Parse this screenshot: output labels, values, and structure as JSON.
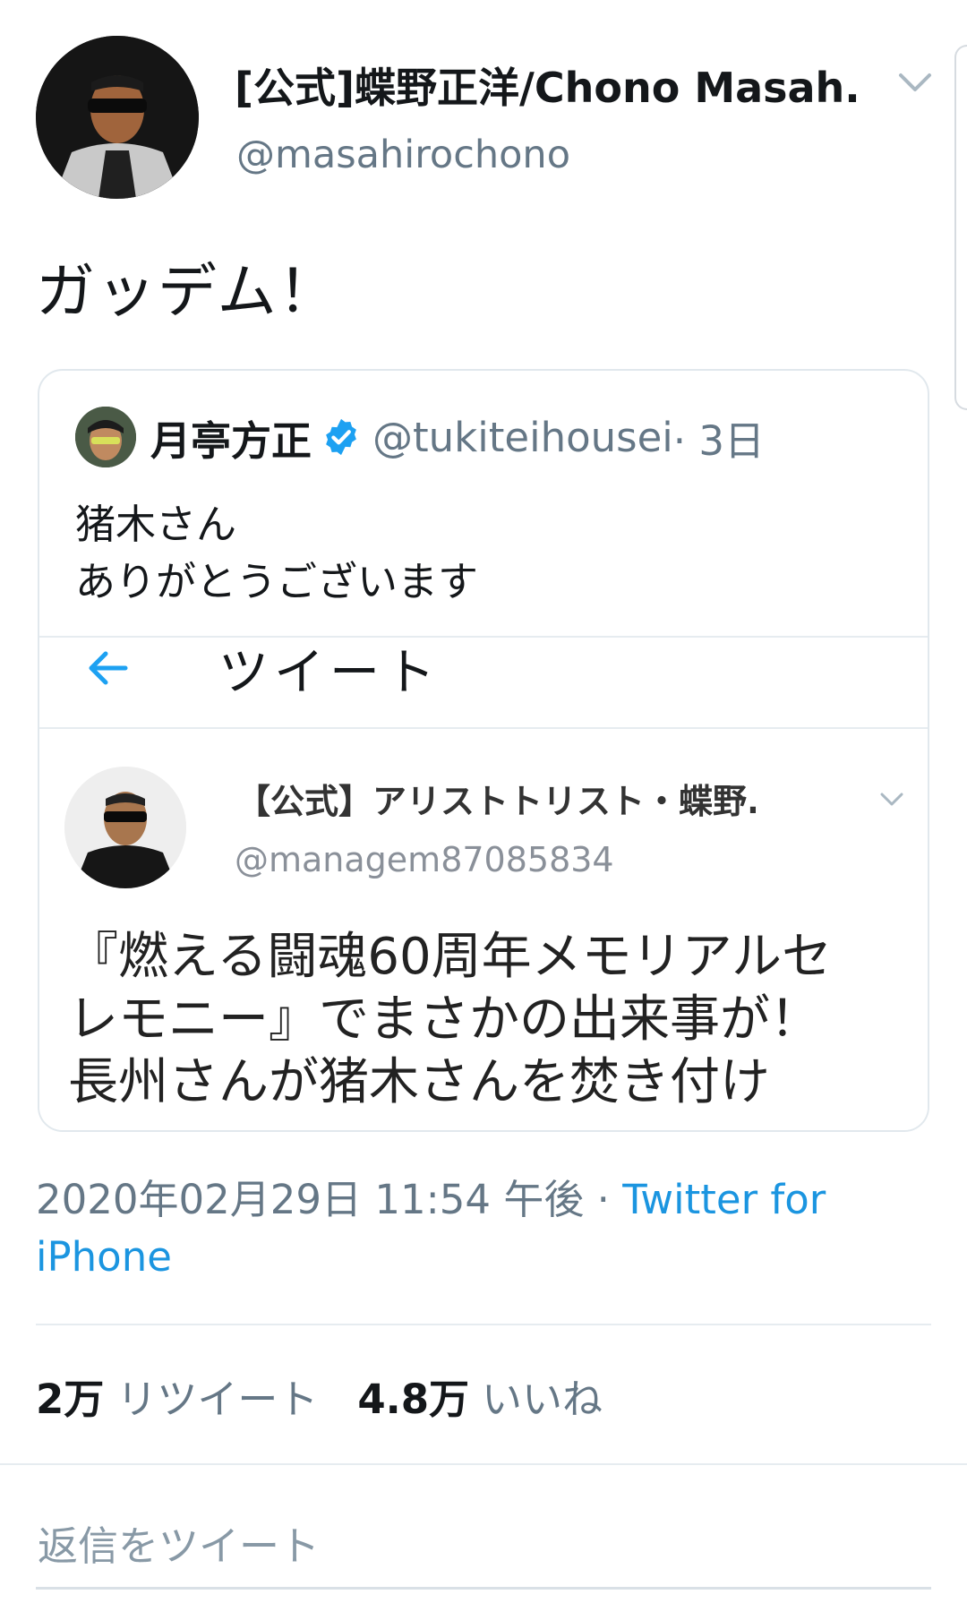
{
  "author": {
    "name": "[公式]蝶野正洋/Chono Masah...",
    "handle": "@masahirochono"
  },
  "tweet": {
    "text": "ガッデム！"
  },
  "quote": {
    "name": "月亭方正",
    "handle": "@tukiteihousei",
    "time": " · 3日",
    "lines": [
      "猪木さん",
      "ありがとうございます"
    ],
    "screenshot": {
      "title": "ツイート",
      "name": "【公式】アリストトリスト・蝶野...",
      "handle": "@managem87085834",
      "text_lines": [
        "『燃える闘魂60周年メモリアルセ",
        "レモニー』でまさかの出来事が！",
        "長州さんが猪木さんを焚き付け"
      ]
    }
  },
  "meta": {
    "datetime": "2020年02月29日 11:54 午後 · ",
    "source": "Twitter for iPhone"
  },
  "stats": {
    "retweets_count": "2万",
    "retweets_label": "リツイート",
    "likes_count": "4.8万",
    "likes_label": "いいね"
  },
  "reply": {
    "placeholder": "返信をツイート"
  },
  "icons": {
    "menu": "chevron-down-icon",
    "verified": "verified-badge-icon",
    "back": "back-arrow-icon"
  },
  "colors": {
    "link": "#1b95e0",
    "secondary_text": "#657786",
    "verified": "#1da1f2"
  }
}
